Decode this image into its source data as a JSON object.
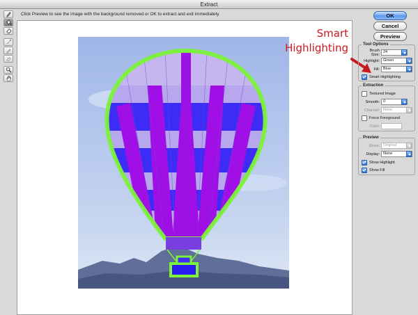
{
  "window": {
    "title": "Extract"
  },
  "hint": "Click Preview to see the image with the background removed or OK to extract and exit immediately.",
  "tools": [
    {
      "name": "edge-highlighter-tool-icon"
    },
    {
      "name": "fill-tool-icon"
    },
    {
      "name": "eraser-tool-icon"
    },
    {
      "name": "eyedropper-tool-icon"
    },
    {
      "name": "cleanup-tool-icon"
    },
    {
      "name": "edge-touchup-tool-icon"
    },
    {
      "name": "zoom-tool-icon"
    },
    {
      "name": "hand-tool-icon"
    }
  ],
  "buttons": {
    "ok": "OK",
    "cancel": "Cancel",
    "preview": "Preview"
  },
  "callout": {
    "line1": "Smart",
    "line2": "Highlighting"
  },
  "tool_options": {
    "title": "Tool Options",
    "brush_size_label": "Brush Size:",
    "brush_size": "24",
    "highlight_label": "Highlight:",
    "highlight": "Green",
    "fill_label": "Fill:",
    "fill": "Blue",
    "smart_highlighting_label": "Smart Highlighting",
    "smart_highlighting": true
  },
  "extraction": {
    "title": "Extraction",
    "textured_image_label": "Textured Image",
    "textured_image": false,
    "smooth_label": "Smooth:",
    "smooth": "0",
    "channel_label": "Channel:",
    "channel": "None",
    "force_foreground_label": "Force Foreground",
    "force_foreground": false,
    "color_label": "Color:"
  },
  "preview": {
    "title": "Preview",
    "show_label": "Show:",
    "show": "Original",
    "display_label": "Display:",
    "display": "None",
    "show_highlight_label": "Show Highlight",
    "show_highlight": true,
    "show_fill_label": "Show Fill",
    "show_fill": true
  },
  "colors": {
    "highlight_green": "#7cf23a",
    "fill_blue": "#3d2cf5",
    "fill_purple": "#a010e6",
    "callout_red": "#c8191f",
    "accent_blue": "#2f6fd9"
  }
}
